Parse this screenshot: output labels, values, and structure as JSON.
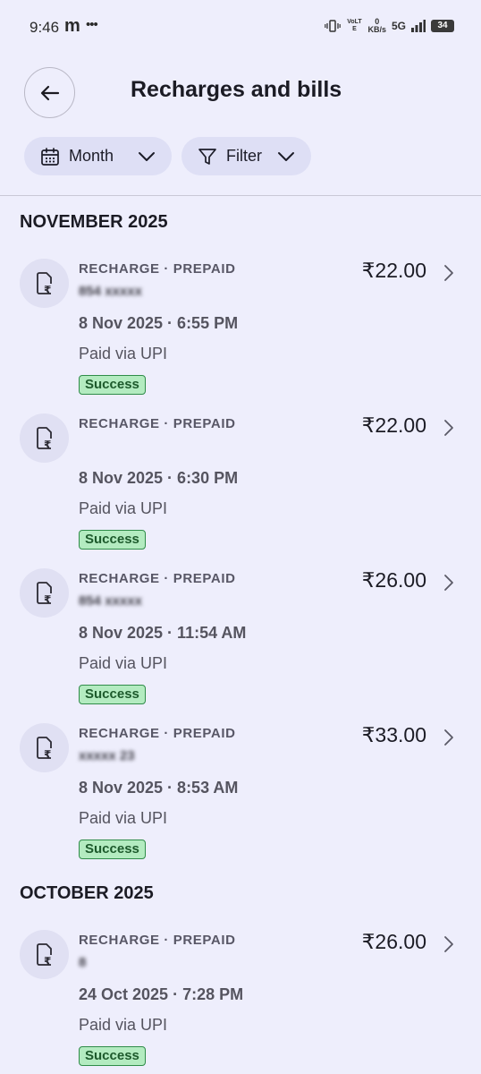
{
  "status_bar": {
    "time": "9:46",
    "carrier_icon": "m",
    "more": "•••",
    "volte": "VoLTE",
    "speed_value": "0",
    "speed_unit": "KB/s",
    "network": "5G",
    "battery": "34"
  },
  "header": {
    "title": "Recharges and bills",
    "back_icon": "arrow-left-icon"
  },
  "filters": {
    "month_label": "Month",
    "filter_label": "Filter"
  },
  "sections": [
    {
      "heading": "NOVEMBER 2025",
      "items": [
        {
          "type": "RECHARGE · PREPAID",
          "number": "854 xxxxx",
          "amount": "₹22.00",
          "date": "8 Nov 2025 · 6:55 PM",
          "payment": "Paid via UPI",
          "status": "Success"
        },
        {
          "type": "RECHARGE · PREPAID",
          "number": "",
          "amount": "₹22.00",
          "date": "8 Nov 2025 · 6:30 PM",
          "payment": "Paid via UPI",
          "status": "Success"
        },
        {
          "type": "RECHARGE · PREPAID",
          "number": "854 xxxxx",
          "amount": "₹26.00",
          "date": "8 Nov 2025 · 11:54 AM",
          "payment": "Paid via UPI",
          "status": "Success"
        },
        {
          "type": "RECHARGE · PREPAID",
          "number": "xxxxx 23",
          "amount": "₹33.00",
          "date": "8 Nov 2025 · 8:53 AM",
          "payment": "Paid via UPI",
          "status": "Success"
        }
      ]
    },
    {
      "heading": "OCTOBER 2025",
      "items": [
        {
          "type": "RECHARGE · PREPAID",
          "number": "8",
          "amount": "₹26.00",
          "date": "24 Oct 2025 · 7:28 PM",
          "payment": "Paid via UPI",
          "status": "Success"
        }
      ]
    }
  ]
}
